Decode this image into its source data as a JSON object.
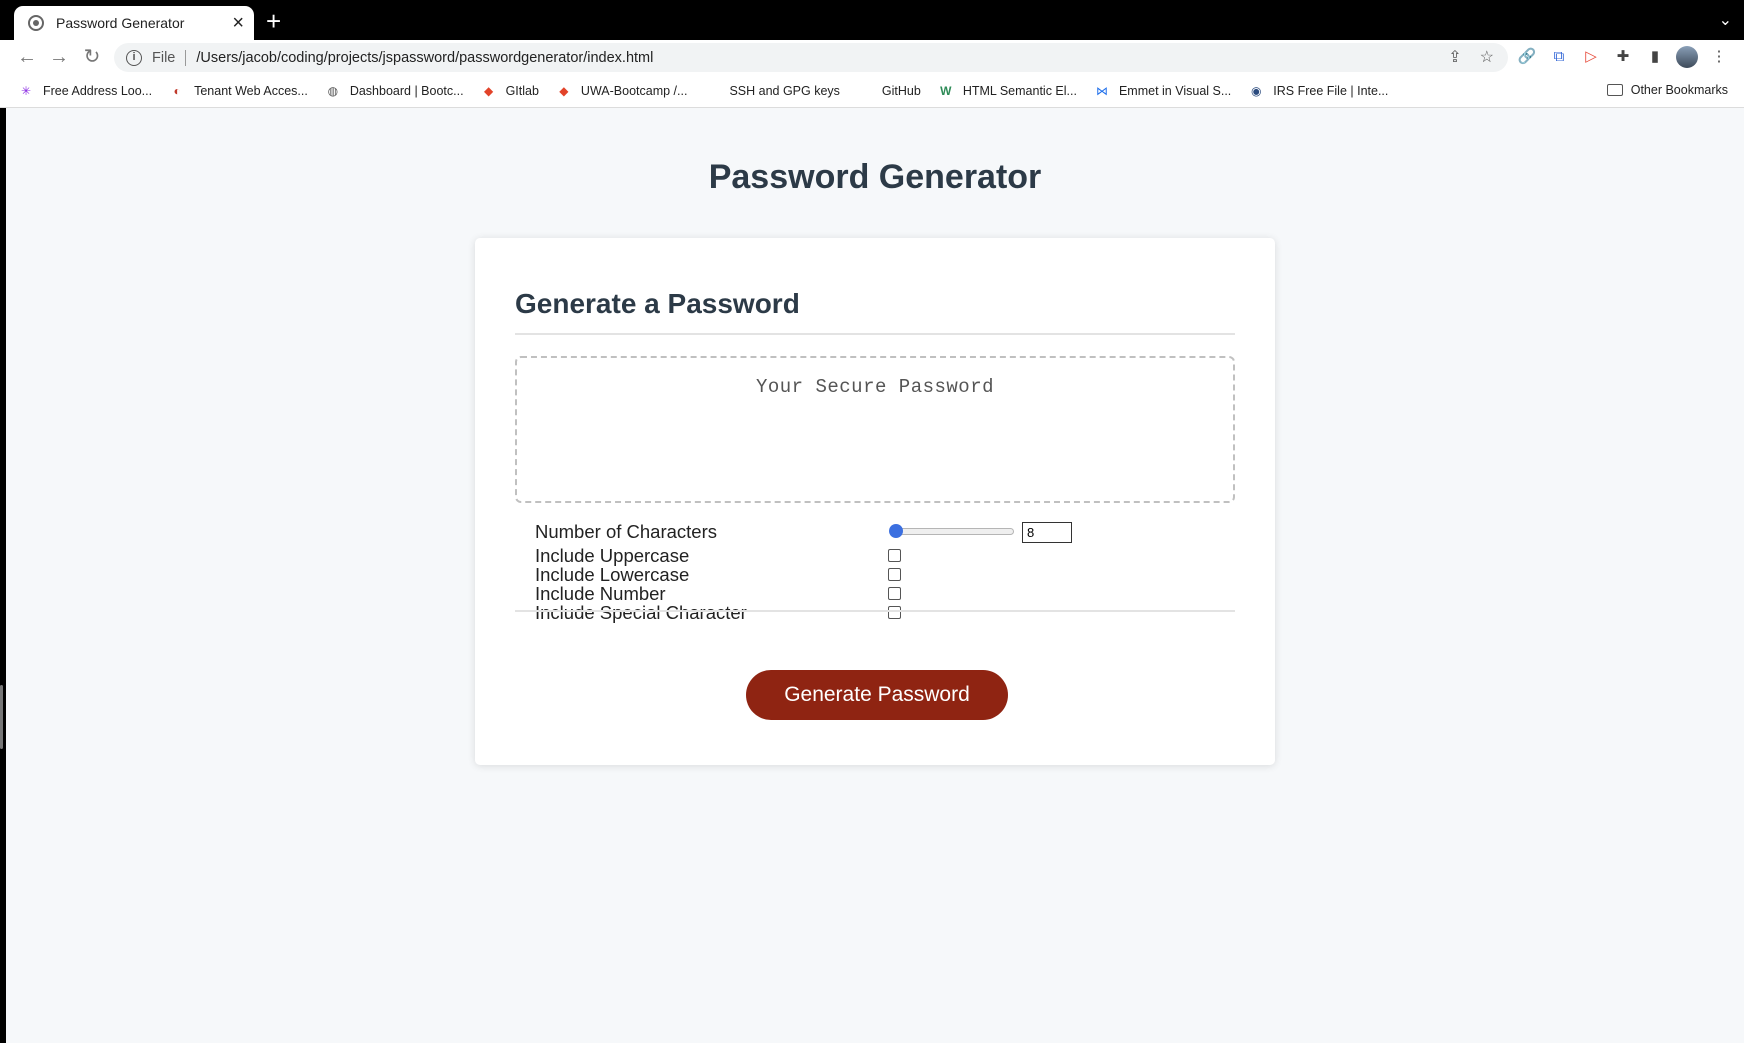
{
  "browser": {
    "tab_title": "Password Generator",
    "tab_close": "×",
    "new_tab": "+",
    "tab_menu": "⌄",
    "scheme": "File",
    "url": "/Users/jacob/coding/projects/jspassword/passwordgenerator/index.html"
  },
  "bookmarks": [
    {
      "label": "Free Address Loo...",
      "icon": "✳",
      "color": "#8a2be2"
    },
    {
      "label": "Tenant Web Acces...",
      "icon": "◐",
      "color": "#c0392b"
    },
    {
      "label": "Dashboard | Bootc...",
      "icon": "◍",
      "color": "#555555"
    },
    {
      "label": "GItlab",
      "icon": "◆",
      "color": "#e24329"
    },
    {
      "label": "UWA-Bootcamp /...",
      "icon": "◆",
      "color": "#e24329"
    },
    {
      "label": "SSH and GPG keys",
      "icon": "",
      "color": "#ffffff"
    },
    {
      "label": "GitHub",
      "icon": "",
      "color": "#ffffff"
    },
    {
      "label": "HTML Semantic El...",
      "icon": "W",
      "color": "#2e8b57"
    },
    {
      "label": "Emmet in Visual S...",
      "icon": "⋈",
      "color": "#1f6feb"
    },
    {
      "label": "IRS Free File | Inte...",
      "icon": "◉",
      "color": "#2b4b7e"
    }
  ],
  "other_bookmarks": "Other Bookmarks",
  "page": {
    "title": "Password Generator",
    "card_title": "Generate a Password",
    "password_placeholder": "Your Secure Password",
    "options": {
      "length_label": "Number of Characters",
      "length_value": "8",
      "uppercase_label": "Include Uppercase",
      "lowercase_label": "Include Lowercase",
      "number_label": "Include Number",
      "special_label": "Include Special Character"
    },
    "button_label": "Generate Password",
    "accent_color": "#8f2412"
  }
}
